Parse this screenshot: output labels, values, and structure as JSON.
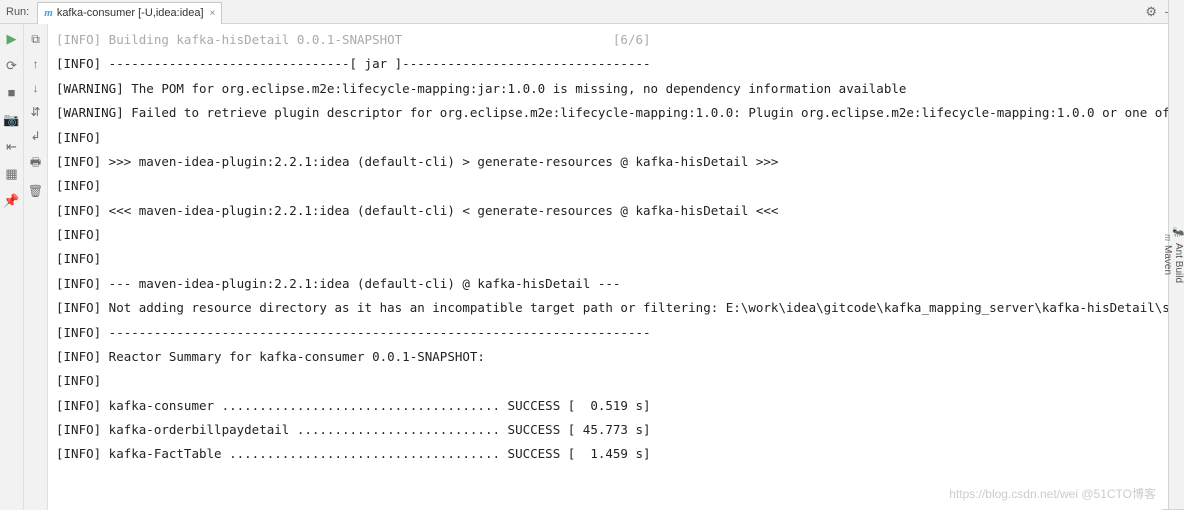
{
  "header": {
    "run_label": "Run:",
    "tab_icon_text": "m",
    "tab_title": "kafka-consumer [-U,idea:idea]",
    "tab_close": "×"
  },
  "right_tabs": {
    "ant_build": "Ant Build",
    "maven": "Maven"
  },
  "gutter_icons": {
    "play": "▶",
    "rerun": "⟳",
    "stop": "■",
    "camera": "📷",
    "exit": "⇤",
    "layout": "▦",
    "pin": "📌"
  },
  "gutter2_icons": {
    "threads": "⧉",
    "up": "↑",
    "down": "↓",
    "toggle": "⇵",
    "wrap": "↲",
    "print": "🖶",
    "trash": "🗑"
  },
  "console_lines": [
    "[INFO] Building kafka-hisDetail 0.0.1-SNAPSHOT                            [6/6]",
    "[INFO] --------------------------------[ jar ]---------------------------------",
    "[WARNING] The POM for org.eclipse.m2e:lifecycle-mapping:jar:1.0.0 is missing, no dependency information available",
    "[WARNING] Failed to retrieve plugin descriptor for org.eclipse.m2e:lifecycle-mapping:1.0.0: Plugin org.eclipse.m2e:lifecycle-mapping:1.0.0 or one of its dep",
    "[INFO] ",
    "[INFO] >>> maven-idea-plugin:2.2.1:idea (default-cli) > generate-resources @ kafka-hisDetail >>>",
    "[INFO] ",
    "[INFO] <<< maven-idea-plugin:2.2.1:idea (default-cli) < generate-resources @ kafka-hisDetail <<<",
    "[INFO] ",
    "[INFO] ",
    "[INFO] --- maven-idea-plugin:2.2.1:idea (default-cli) @ kafka-hisDetail ---",
    "[INFO] Not adding resource directory as it has an incompatible target path or filtering: E:\\work\\idea\\gitcode\\kafka_mapping_server\\kafka-hisDetail\\src\\main\\",
    "[INFO] ------------------------------------------------------------------------",
    "[INFO] Reactor Summary for kafka-consumer 0.0.1-SNAPSHOT:",
    "[INFO] ",
    "[INFO] kafka-consumer ..................................... SUCCESS [  0.519 s]",
    "[INFO] kafka-orderbillpaydetail ........................... SUCCESS [ 45.773 s]",
    "[INFO] kafka-FactTable .................................... SUCCESS [  1.459 s]"
  ],
  "watermark": "https://blog.csdn.net/wei @51CTO博客"
}
